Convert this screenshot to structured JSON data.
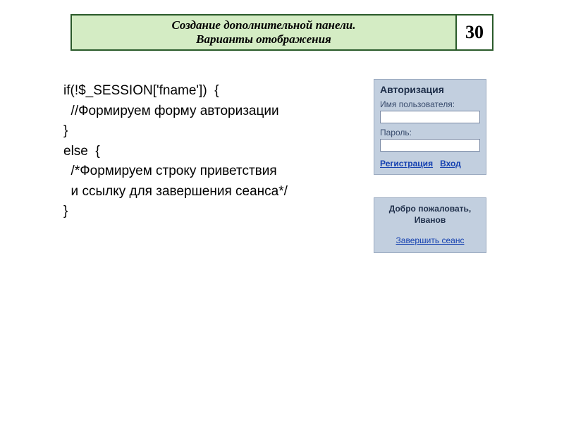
{
  "header": {
    "title_line1": "Создание дополнительной панели.",
    "title_line2": "Варианты отображения",
    "number": "30"
  },
  "code": {
    "l1": "if(!$_SESSION['fname'])  {",
    "l2": "",
    "l3": "  //Формируем форму авторизации",
    "l4": "",
    "l5": "}",
    "l6": "",
    "l7": "",
    "l8": "else  {",
    "l9": "  /*Формируем строку приветствия",
    "l10": "  и ссылку для завершения сеанса*/",
    "l11": "}"
  },
  "auth": {
    "title": "Авторизация",
    "username_label": "Имя пользователя:",
    "password_label": "Пароль:",
    "register": "Регистрация",
    "login": "Вход",
    "username_value": "",
    "password_value": ""
  },
  "welcome": {
    "line1": "Добро пожаловать,",
    "line2": "Иванов",
    "logout": "Завершить сеанс"
  }
}
